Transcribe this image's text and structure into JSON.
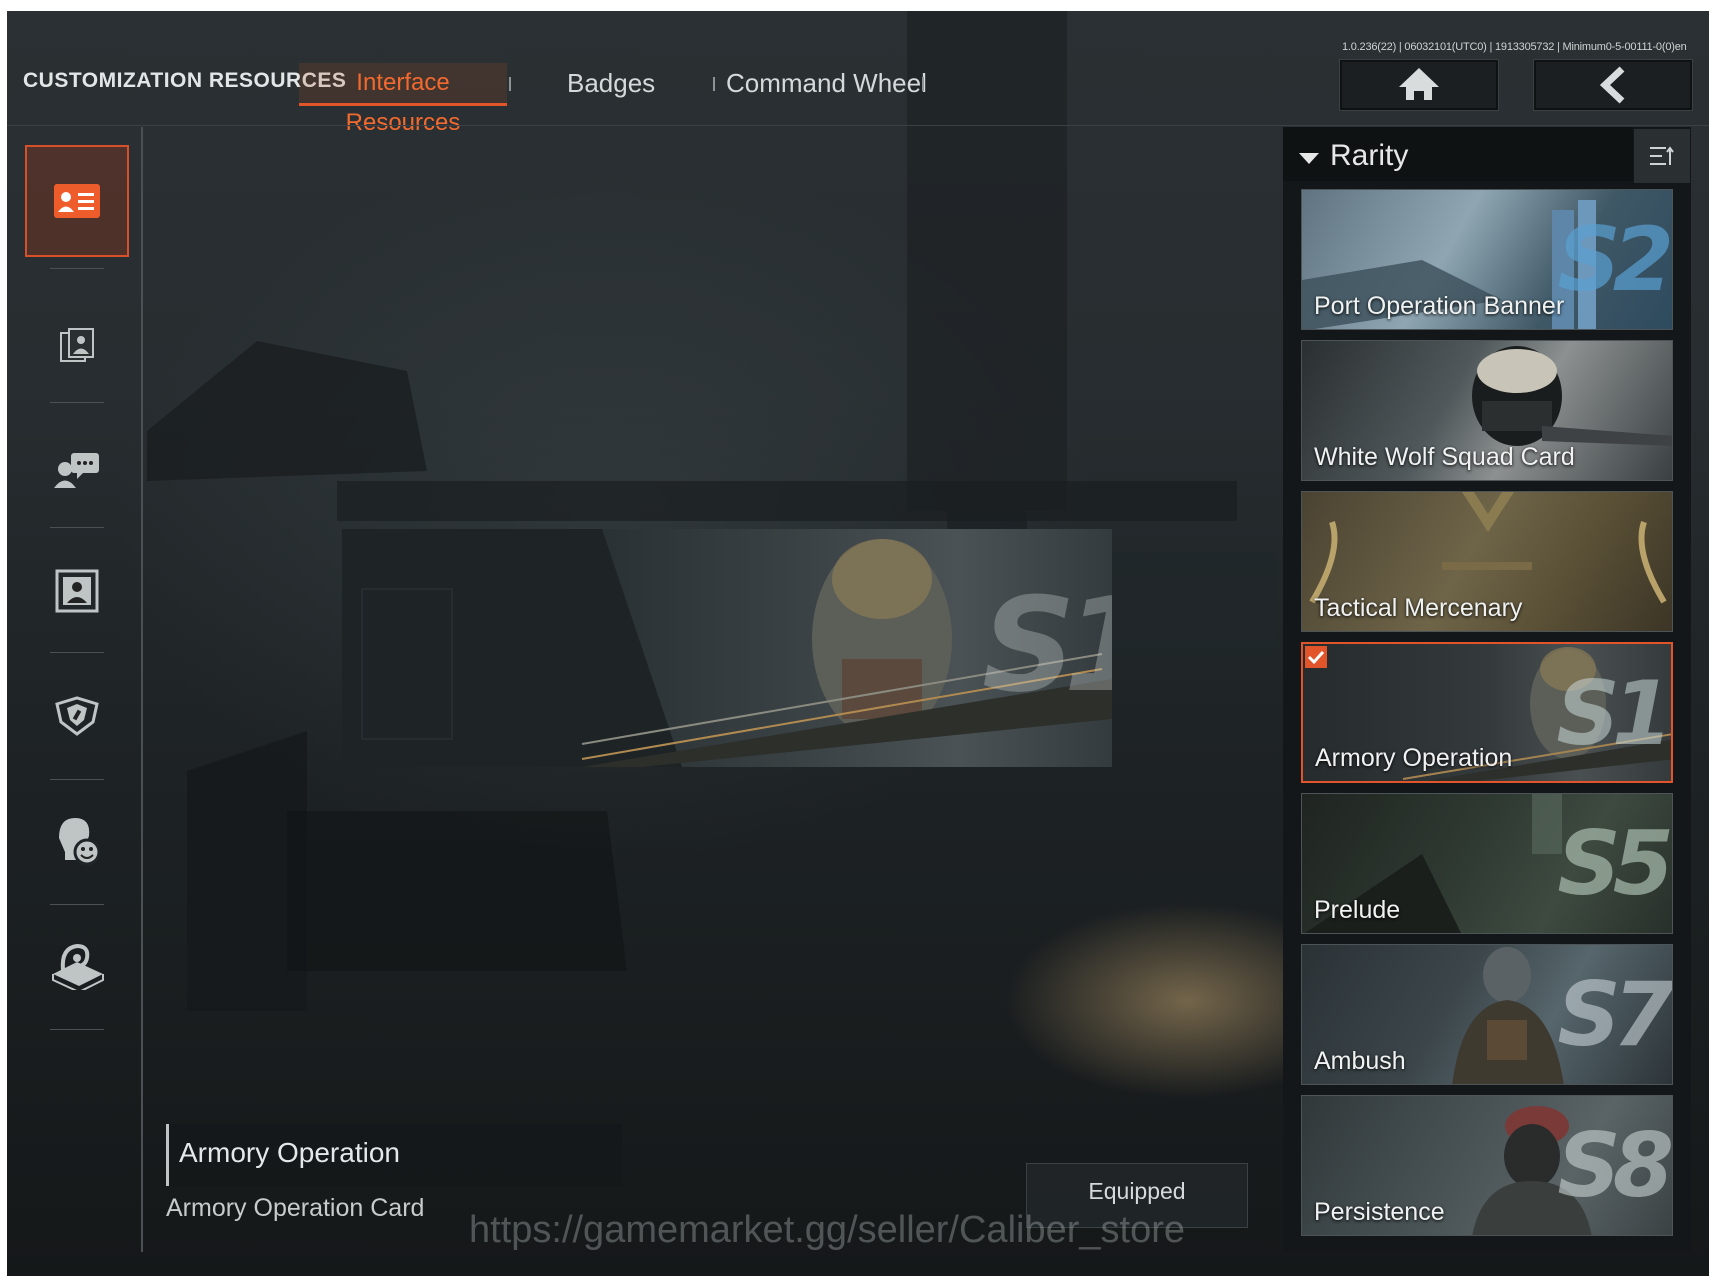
{
  "header": {
    "title": "CUSTOMIZATION RESOURCES",
    "tabs": [
      {
        "label": "Interface Resources",
        "active": true
      },
      {
        "label": "Badges",
        "active": false
      },
      {
        "label": "Command Wheel",
        "active": false
      }
    ],
    "version": "1.0.236(22) | 06032101(UTC0) | 1913305732 | Minimum0-5-00111-0(0)en",
    "home_icon": "home-icon",
    "back_icon": "back-arrow-icon"
  },
  "sidebar": {
    "items": [
      {
        "icon": "id-card-icon",
        "active": true
      },
      {
        "icon": "portrait-frame-icon",
        "active": false
      },
      {
        "icon": "chat-person-icon",
        "active": false
      },
      {
        "icon": "avatar-frame-icon",
        "active": false
      },
      {
        "icon": "emblem-shield-icon",
        "active": false
      },
      {
        "icon": "emote-face-icon",
        "active": false
      },
      {
        "icon": "spray-tag-icon",
        "active": false
      }
    ]
  },
  "preview": {
    "season_mark": "S1",
    "name": "Armory Operation",
    "subtitle": "Armory Operation Card",
    "equip_label": "Equipped"
  },
  "watermark": "https://gamemarket.gg/seller/Caliber_store",
  "filter": {
    "label": "Rarity",
    "sort_icon": "sort-icon"
  },
  "cards": [
    {
      "name": "Port Operation Banner",
      "season": "S2",
      "selected": false
    },
    {
      "name": "White Wolf Squad Card",
      "season": "",
      "selected": false
    },
    {
      "name": "Tactical Mercenary",
      "season": "",
      "selected": false
    },
    {
      "name": "Armory Operation",
      "season": "S1",
      "selected": true
    },
    {
      "name": "Prelude",
      "season": "S5",
      "selected": false
    },
    {
      "name": "Ambush",
      "season": "S7",
      "selected": false
    },
    {
      "name": "Persistence",
      "season": "S8",
      "selected": false
    }
  ],
  "colors": {
    "accent": "#e2552a",
    "active_tab_text": "#f26a2e"
  }
}
